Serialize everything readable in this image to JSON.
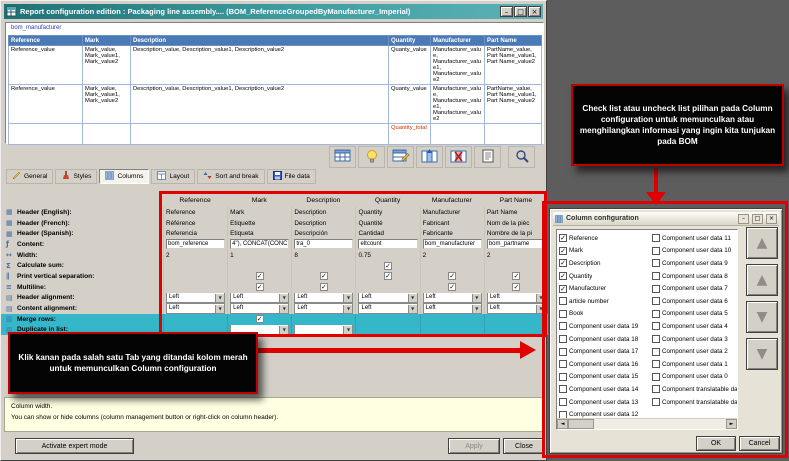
{
  "icons": {
    "check": "✓",
    "dropdown_arrow": "▼",
    "scroll_left": "◄",
    "scroll_right": "►",
    "arrow_up": "▲",
    "arrow_down": "▼",
    "minimize": "–",
    "maximize": "□",
    "close": "×"
  },
  "window": {
    "title": "Report configuration edition : Packaging line assembly.... (BOM_ReferenceGroupedByManufacturer_Imperial)"
  },
  "preview": {
    "table_name": "bom_manufacturer",
    "columns": [
      "Reference",
      "Mark",
      "Description",
      "Quantity",
      "Manufacturer",
      "Part Name"
    ],
    "rows": [
      [
        "Reference_value",
        "Mark_value, Mark_value1, Mark_value2",
        "Description_value, Description_value1, Description_value2",
        "Quanty_value",
        "Manufacturer_value, Manufacturer_value1, Manufacturer_value2",
        "PartName_value, Part Name_value1, Part Name_value2"
      ],
      [
        "Reference_value",
        "Mark_value, Mark_value1, Mark_value2",
        "Description_value, Description_value1, Description_value2",
        "Quanty_value",
        "Manufacturer_value, Manufacturer_value1, Manufacturer_value2",
        "PartName_value, Part Name_value1, Part Name_value2"
      ]
    ],
    "total_row": [
      "",
      "",
      "",
      "Quantity_total",
      "",
      ""
    ]
  },
  "tabs": [
    {
      "label": "General",
      "active": false
    },
    {
      "label": "Styles",
      "active": false
    },
    {
      "label": "Columns",
      "active": true
    },
    {
      "label": "Layout",
      "active": false
    },
    {
      "label": "Sort and break",
      "active": false
    },
    {
      "label": "File data",
      "active": false
    }
  ],
  "grid": {
    "columns": [
      "Reference",
      "Mark",
      "Description",
      "Quantity",
      "Manufacturer",
      "Part Name"
    ],
    "rows": [
      {
        "label": "Header (English):",
        "icon": "▦",
        "type": "text",
        "cells": [
          "Reference",
          "Mark",
          "Description",
          "Quantity",
          "Manufacturer",
          "Part Name"
        ]
      },
      {
        "label": "Header (French):",
        "icon": "▦",
        "type": "text",
        "cells": [
          "Référence",
          "Etiquette",
          "Description",
          "Quantité",
          "Fabricant",
          "Nom de la pièc"
        ]
      },
      {
        "label": "Header (Spanish):",
        "icon": "▦",
        "type": "text",
        "cells": [
          "Referencia",
          "Etiqueta",
          "Descripción",
          "Cantidad",
          "Fabricante",
          "Nombre de la pi"
        ]
      },
      {
        "label": "Content:",
        "icon": "ƒ",
        "type": "input",
        "cells": [
          "bom_reference",
          "4\"), CONCAT(CONC",
          "tra_0",
          "eltcount",
          "bom_manufacturer",
          "bom_partname"
        ]
      },
      {
        "label": "Width:",
        "icon": "↔",
        "type": "text",
        "cells": [
          "2",
          "1",
          "8",
          "0.75",
          "2",
          "2"
        ]
      },
      {
        "label": "Calculate sum:",
        "icon": "Σ",
        "type": "checkbox",
        "cells": [
          null,
          null,
          null,
          true,
          null,
          null
        ]
      },
      {
        "label": "Print vertical separation:",
        "icon": "∥",
        "type": "checkbox",
        "cells": [
          null,
          true,
          true,
          true,
          true,
          true
        ]
      },
      {
        "label": "Multiline:",
        "icon": "≡",
        "type": "checkbox",
        "cells": [
          null,
          true,
          true,
          null,
          true,
          true
        ]
      },
      {
        "label": "Header alignment:",
        "icon": "▤",
        "type": "select",
        "cells": [
          "Left",
          "Left",
          "Left",
          "Left",
          "Left",
          "Left"
        ]
      },
      {
        "label": "Content alignment:",
        "icon": "▤",
        "type": "select",
        "cells": [
          "Left",
          "Left",
          "Left",
          "Left",
          "Left",
          "Left"
        ]
      },
      {
        "label": "Merge rows:",
        "icon": "▥",
        "type": "checkbox",
        "highlight": true,
        "cells": [
          null,
          true,
          null,
          null,
          null,
          null
        ]
      },
      {
        "label": "Duplicate in list:",
        "icon": "▥",
        "type": "select",
        "highlight": true,
        "cells": [
          null,
          "",
          "",
          null,
          null,
          null
        ]
      }
    ]
  },
  "status": {
    "line1": "Column width.",
    "line2": "You can show or hide columns (column management button or right-click on column header)."
  },
  "footer": {
    "expert_button": "Activate expert mode",
    "apply": "Apply",
    "close": "Close"
  },
  "column_config": {
    "title": "Column configuration",
    "left_items": [
      {
        "label": "Reference",
        "checked": true
      },
      {
        "label": "Mark",
        "checked": true
      },
      {
        "label": "Description",
        "checked": true
      },
      {
        "label": "Quantity",
        "checked": true
      },
      {
        "label": "Manufacturer",
        "checked": true
      },
      {
        "label": "article number",
        "checked": false
      },
      {
        "label": "Book",
        "checked": false
      },
      {
        "label": "Component user data 19",
        "checked": false
      },
      {
        "label": "Component user data 18",
        "checked": false
      },
      {
        "label": "Component user data 17",
        "checked": false
      },
      {
        "label": "Component user data 16",
        "checked": false
      },
      {
        "label": "Component user data 15",
        "checked": false
      },
      {
        "label": "Component user data 14",
        "checked": false
      },
      {
        "label": "Component user data 13",
        "checked": false
      },
      {
        "label": "Component user data 12",
        "checked": false
      }
    ],
    "right_items": [
      {
        "label": "Component user data 11",
        "checked": false
      },
      {
        "label": "Component user data 10",
        "checked": false
      },
      {
        "label": "Component user data 9",
        "checked": false
      },
      {
        "label": "Component user data 8",
        "checked": false
      },
      {
        "label": "Component user data 7",
        "checked": false
      },
      {
        "label": "Component user data 6",
        "checked": false
      },
      {
        "label": "Component user data 5",
        "checked": false
      },
      {
        "label": "Component user data 4",
        "checked": false
      },
      {
        "label": "Component user data 3",
        "checked": false
      },
      {
        "label": "Component user data 2",
        "checked": false
      },
      {
        "label": "Component user data 1",
        "checked": false
      },
      {
        "label": "Component user data 0",
        "checked": false
      },
      {
        "label": "Component translatable dat",
        "checked": false
      },
      {
        "label": "Component translatable dat",
        "checked": false
      }
    ],
    "ok": "OK",
    "cancel": "Cancel"
  },
  "annotations": {
    "callout_top": "Check list atau uncheck list pilihan pada Column configuration untuk memunculkan atau menghilangkan informasi yang ingin kita tunjukan pada BOM",
    "callout_left": "Klik kanan pada salah satu Tab yang ditandai kolom merah untuk memunculkan Column configuration"
  },
  "colors": {
    "annotation_red": "#e10000",
    "highlight_cyan": "#35b6c9",
    "table_header_blue": "#4a7ab5",
    "titlebar_teal": "#2e8a8c"
  }
}
